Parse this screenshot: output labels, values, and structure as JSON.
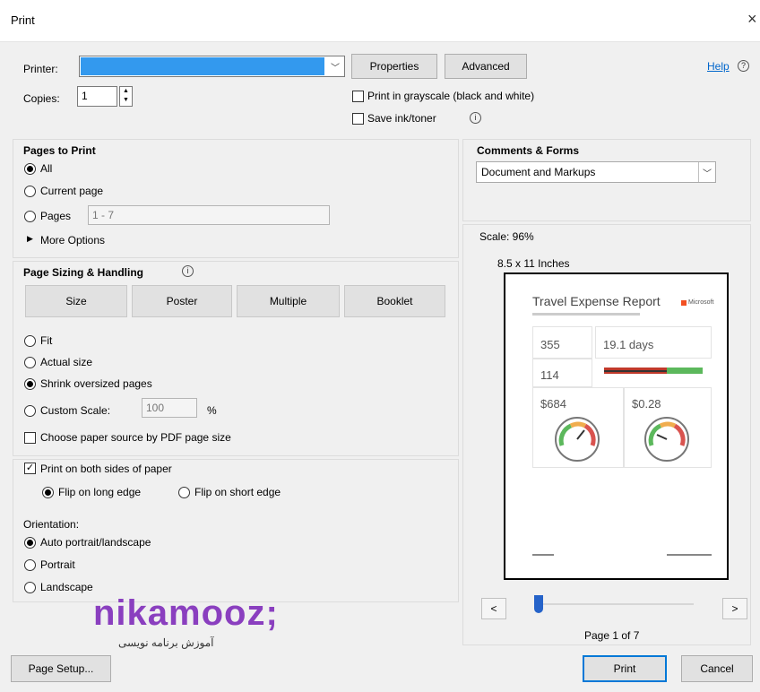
{
  "window": {
    "title": "Print",
    "close": "×"
  },
  "printer": {
    "label": "Printer:",
    "value": "",
    "properties": "Properties",
    "advanced": "Advanced",
    "help": "Help"
  },
  "copies": {
    "label": "Copies:",
    "value": "1"
  },
  "options": {
    "grayscale": "Print in grayscale (black and white)",
    "save_ink": "Save ink/toner"
  },
  "pages_to_print": {
    "heading": "Pages to Print",
    "all": "All",
    "current": "Current page",
    "pages": "Pages",
    "pages_value": "1 - 7",
    "more": "More Options"
  },
  "sizing": {
    "heading": "Page Sizing & Handling",
    "buttons": [
      "Size",
      "Poster",
      "Multiple",
      "Booklet"
    ],
    "fit": "Fit",
    "actual": "Actual size",
    "shrink": "Shrink oversized pages",
    "custom": "Custom Scale:",
    "custom_value": "100",
    "percent": "%",
    "paper_source": "Choose paper source by PDF page size"
  },
  "duplex": {
    "both_sides": "Print on both sides of paper",
    "long_edge": "Flip on long edge",
    "short_edge": "Flip on short edge"
  },
  "orientation": {
    "heading": "Orientation:",
    "auto": "Auto portrait/landscape",
    "portrait": "Portrait",
    "landscape": "Landscape"
  },
  "comments": {
    "heading": "Comments & Forms",
    "value": "Document and Markups"
  },
  "preview": {
    "scale": "Scale: 96%",
    "paper": "8.5 x 11 Inches",
    "page_indicator": "Page 1 of 7",
    "prev": "<",
    "next": ">",
    "slider_fraction": 0.0,
    "doc": {
      "title": "Travel Expense Report",
      "brand": "Microsoft",
      "values": [
        "355",
        "19.1 days",
        "114",
        "$684",
        "$0.28"
      ]
    }
  },
  "watermark": {
    "brand": "nikamooz;",
    "tagline": "آموزش برنامه نویسی"
  },
  "footer": {
    "page_setup": "Page Setup...",
    "print": "Print",
    "cancel": "Cancel"
  }
}
